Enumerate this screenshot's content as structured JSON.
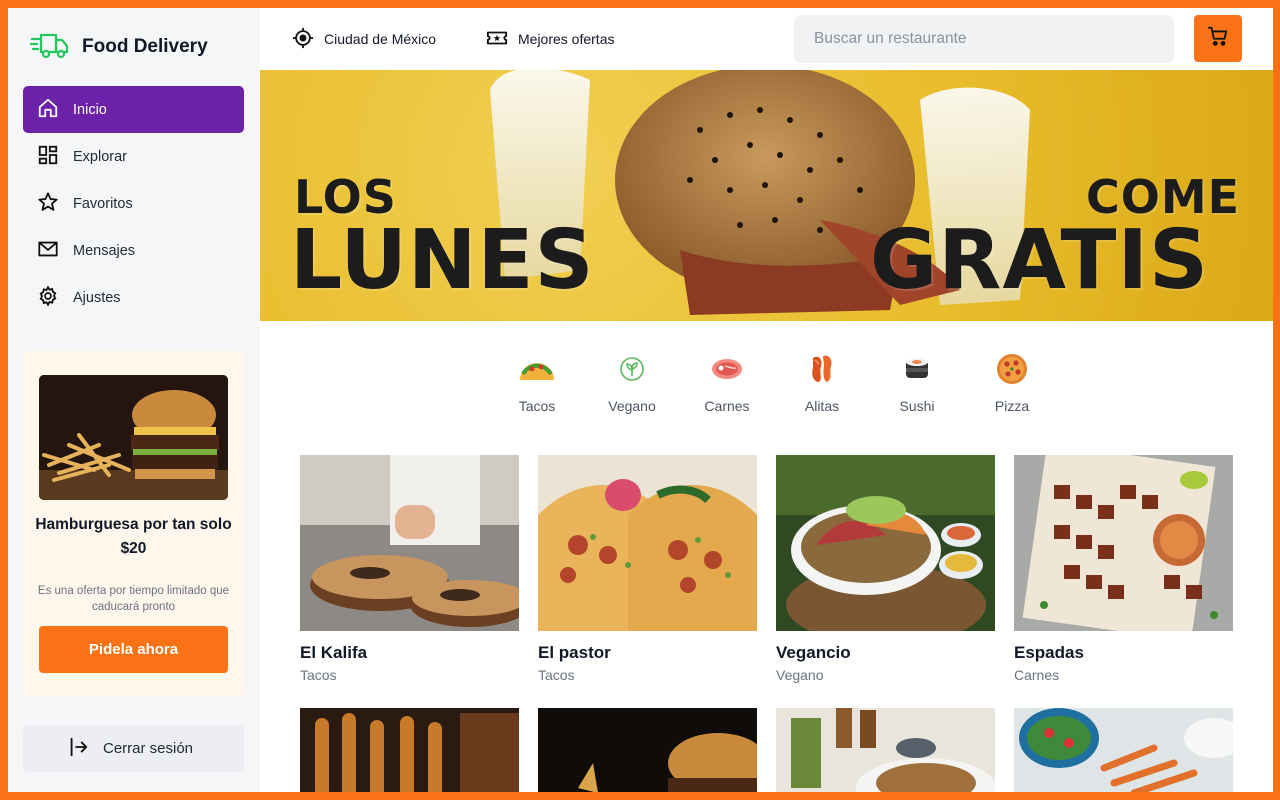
{
  "brand": {
    "title": "Food Delivery"
  },
  "sidebar": {
    "items": [
      {
        "label": "Inicio",
        "icon": "home-icon",
        "active": true
      },
      {
        "label": "Explorar",
        "icon": "grid-icon"
      },
      {
        "label": "Favoritos",
        "icon": "star-icon"
      },
      {
        "label": "Mensajes",
        "icon": "mail-icon"
      },
      {
        "label": "Ajustes",
        "icon": "gear-icon"
      }
    ],
    "promo": {
      "title": "Hamburguesa por tan solo $20",
      "description": "Es una oferta por tiempo limitado que caducará pronto",
      "button": "Pidela ahora"
    },
    "logout": "Cerrar sesión"
  },
  "topbar": {
    "location": "Ciudad de México",
    "offers": "Mejores ofertas",
    "search_placeholder": "Buscar un restaurante"
  },
  "banner": {
    "line1_left": "LOS",
    "line2_left": "LUNES",
    "line1_right": "COME",
    "line2_right": "GRATIS"
  },
  "categories": [
    {
      "label": "Tacos",
      "icon": "taco-icon"
    },
    {
      "label": "Vegano",
      "icon": "leaf-icon"
    },
    {
      "label": "Carnes",
      "icon": "steak-icon"
    },
    {
      "label": "Alitas",
      "icon": "wings-icon"
    },
    {
      "label": "Sushi",
      "icon": "sushi-icon"
    },
    {
      "label": "Pizza",
      "icon": "pizza-icon"
    }
  ],
  "restaurants": [
    {
      "name": "El Kalifa",
      "type": "Tacos"
    },
    {
      "name": "El pastor",
      "type": "Tacos"
    },
    {
      "name": "Vegancio",
      "type": "Vegano"
    },
    {
      "name": "Espadas",
      "type": "Carnes"
    }
  ],
  "colors": {
    "accent": "#f97316",
    "active_nav": "#6b21a8",
    "brand_green": "#22c55e"
  }
}
